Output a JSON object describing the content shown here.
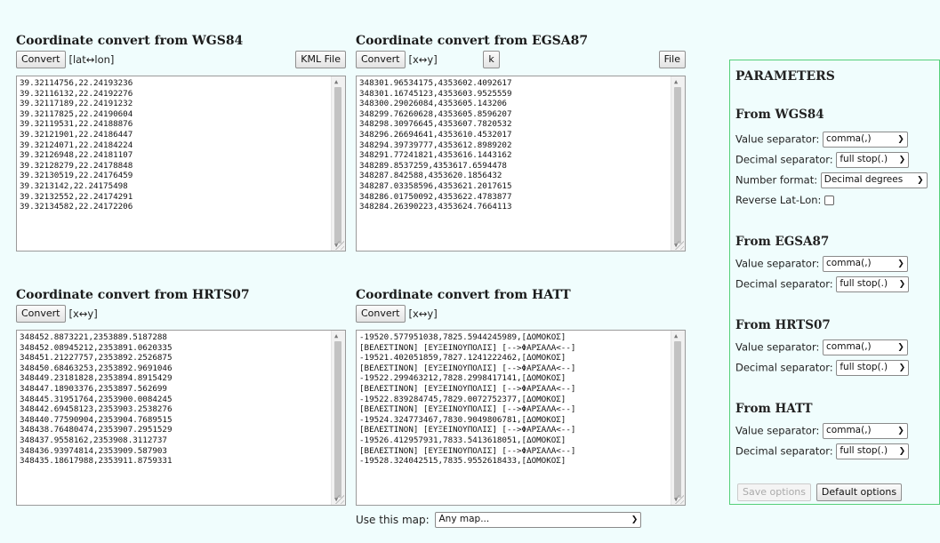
{
  "wgs84": {
    "title": "Coordinate convert from WGS84",
    "convert_label": "Convert",
    "swap_hint": "[lat↔lon]",
    "file_label": "KML File",
    "lines": [
      "39.32114756,22.24193236",
      "39.32116132,22.24192276",
      "39.32117189,22.24191232",
      "39.32117825,22.24190604",
      "39.32119531,22.24188876",
      "39.32121901,22.24186447",
      "39.32124071,22.24184224",
      "39.32126948,22.24181107",
      "39.32128279,22.24178848",
      "39.32130519,22.24176459",
      "39.3213142,22.24175498",
      "39.32132552,22.24174291",
      "39.32134582,22.24172206"
    ]
  },
  "egsa87": {
    "title": "Coordinate convert from EGSA87",
    "convert_label": "Convert",
    "swap_hint": "[x↔y]",
    "k_label": "k",
    "file_label": "File",
    "lines": [
      "348301.96534175,4353602.4092617",
      "348301.16745123,4353603.9525559",
      "348300.29026084,4353605.143206",
      "348299.76260628,4353605.8596207",
      "348298.30976645,4353607.7820532",
      "348296.26694641,4353610.4532017",
      "348294.39739777,4353612.8989202",
      "348291.77241821,4353616.1443162",
      "348289.8537259,4353617.6594478",
      "348287.842588,4353620.1856432",
      "348287.03358596,4353621.2017615",
      "348286.01750092,4353622.4783877",
      "348284.26390223,4353624.7664113"
    ]
  },
  "hrts07": {
    "title": "Coordinate convert from HRTS07",
    "convert_label": "Convert",
    "swap_hint": "[x↔y]",
    "lines": [
      "348452.8873221,2353889.5187288",
      "348452.08945212,2353891.0620335",
      "348451.21227757,2353892.2526875",
      "348450.68463253,2353892.9691046",
      "348449.23181828,2353894.8915429",
      "348447.18903376,2353897.562699",
      "348445.31951764,2353900.0084245",
      "348442.69458123,2353903.2538276",
      "348440.77590904,2353904.7689515",
      "348438.76480474,2353907.2951529",
      "348437.9558162,2353908.3112737",
      "348436.93974814,2353909.587903",
      "348435.18617988,2353911.8759331"
    ]
  },
  "hatt": {
    "title": "Coordinate convert from HATT",
    "convert_label": "Convert",
    "swap_hint": "[x↔y]",
    "lines": [
      "-19520.577951038,7825.5944245989,[ΔΟΜΟΚΟΣ]",
      "[ΒΕΛΕΣΤΙΝΟΝ] [ΕΥΞΕΙΝΟΥΠΟΛΙΣ] [-->ΦΑΡΣΑΛΑ<--]",
      "-19521.402051859,7827.1241222462,[ΔΟΜΟΚΟΣ]",
      "[ΒΕΛΕΣΤΙΝΟΝ] [ΕΥΞΕΙΝΟΥΠΟΛΙΣ] [-->ΦΑΡΣΑΛΑ<--]",
      "-19522.299463212,7828.2998417141,[ΔΟΜΟΚΟΣ]",
      "[ΒΕΛΕΣΤΙΝΟΝ] [ΕΥΞΕΙΝΟΥΠΟΛΙΣ] [-->ΦΑΡΣΑΛΑ<--]",
      "-19522.839284745,7829.0072752377,[ΔΟΜΟΚΟΣ]",
      "[ΒΕΛΕΣΤΙΝΟΝ] [ΕΥΞΕΙΝΟΥΠΟΛΙΣ] [-->ΦΑΡΣΑΛΑ<--]",
      "-19524.324773467,7830.9049806781,[ΔΟΜΟΚΟΣ]",
      "[ΒΕΛΕΣΤΙΝΟΝ] [ΕΥΞΕΙΝΟΥΠΟΛΙΣ] [-->ΦΑΡΣΑΛΑ<--]",
      "-19526.412957931,7833.5413618051,[ΔΟΜΟΚΟΣ]",
      "[ΒΕΛΕΣΤΙΝΟΝ] [ΕΥΞΕΙΝΟΥΠΟΛΙΣ] [-->ΦΑΡΣΑΛΑ<--]",
      "-19528.324042515,7835.9552618433,[ΔΟΜΟΚΟΣ]"
    ]
  },
  "map": {
    "label": "Use this map:",
    "selected": "Any map..."
  },
  "params": {
    "title": "PARAMETERS",
    "wgs84": {
      "title": "From WGS84",
      "value_sep_label": "Value separator:",
      "value_sep": "comma(,)",
      "decimal_sep_label": "Decimal separator:",
      "decimal_sep": "full stop(.)",
      "number_format_label": "Number format:",
      "number_format": "Decimal degrees",
      "reverse_label": "Reverse Lat-Lon:",
      "reverse_checked": false
    },
    "egsa87": {
      "title": "From EGSA87",
      "value_sep_label": "Value separator:",
      "value_sep": "comma(,)",
      "decimal_sep_label": "Decimal separator:",
      "decimal_sep": "full stop(.)"
    },
    "hrts07": {
      "title": "From HRTS07",
      "value_sep_label": "Value separator:",
      "value_sep": "comma(,)",
      "decimal_sep_label": "Decimal separator:",
      "decimal_sep": "full stop(.)"
    },
    "hatt": {
      "title": "From HATT",
      "value_sep_label": "Value separator:",
      "value_sep": "comma(,)",
      "decimal_sep_label": "Decimal separator:",
      "decimal_sep": "full stop(.)"
    },
    "save_label": "Save options",
    "default_label": "Default options"
  }
}
